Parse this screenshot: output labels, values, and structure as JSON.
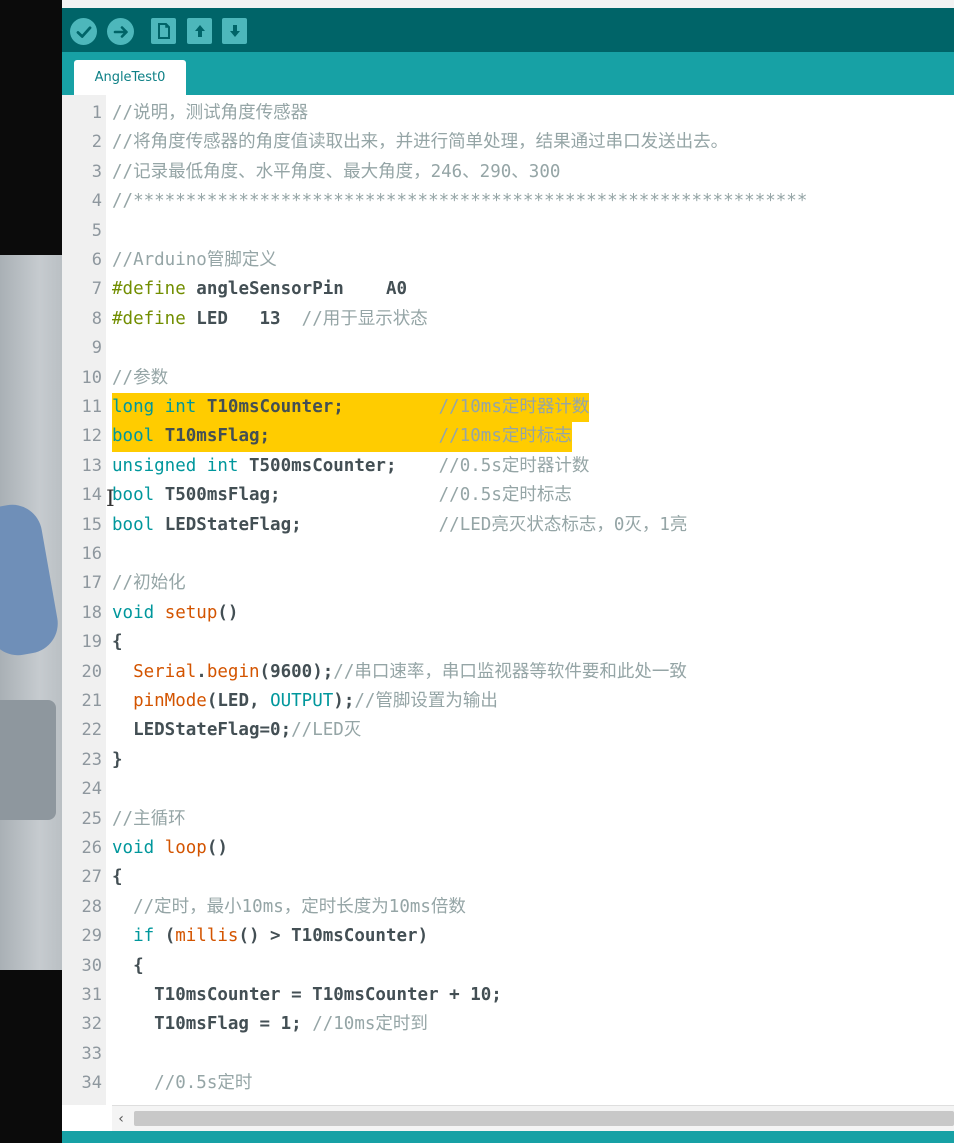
{
  "window": {
    "toolbar": {
      "icons": [
        "verify-icon",
        "upload-icon",
        "new-icon",
        "open-icon",
        "save-icon"
      ],
      "accent": "#006468",
      "button_color": "#4db7bb"
    },
    "tabs": [
      {
        "label": "AngleTest0"
      }
    ],
    "tab_color": "#17a1a5"
  },
  "editor": {
    "highlight_color": "#ffcc00",
    "lines": [
      {
        "n": "1",
        "segs": [
          {
            "t": "//说明，测试角度传感器",
            "c": "cm"
          }
        ]
      },
      {
        "n": "2",
        "segs": [
          {
            "t": "//将角度传感器的角度值读取出来，并进行简单处理，结果通过串口发送出去。",
            "c": "cm"
          }
        ]
      },
      {
        "n": "3",
        "segs": [
          {
            "t": "//记录最低角度、水平角度、最大角度，246、290、300",
            "c": "cm"
          }
        ]
      },
      {
        "n": "4",
        "segs": [
          {
            "t": "//****************************************************************",
            "c": "cm"
          }
        ]
      },
      {
        "n": "5",
        "segs": []
      },
      {
        "n": "6",
        "segs": [
          {
            "t": "//Arduino管脚定义",
            "c": "cm"
          }
        ]
      },
      {
        "n": "7",
        "segs": [
          {
            "t": "#define",
            "c": "pp"
          },
          {
            "t": " angleSensorPin    A0",
            "c": "id"
          }
        ]
      },
      {
        "n": "8",
        "segs": [
          {
            "t": "#define",
            "c": "pp"
          },
          {
            "t": " LED   13  ",
            "c": "id"
          },
          {
            "t": "//用于显示状态",
            "c": "cm"
          }
        ]
      },
      {
        "n": "9",
        "segs": []
      },
      {
        "n": "10",
        "segs": [
          {
            "t": "//参数",
            "c": "cm"
          }
        ]
      },
      {
        "n": "11",
        "hl": true,
        "segs": [
          {
            "t": "long",
            "c": "kw"
          },
          {
            "t": " ",
            "c": "id"
          },
          {
            "t": "int",
            "c": "kw"
          },
          {
            "t": " T10msCounter;         ",
            "c": "id"
          },
          {
            "t": "//10ms定时器计数",
            "c": "cm"
          }
        ]
      },
      {
        "n": "12",
        "hl": true,
        "segs": [
          {
            "t": "bool",
            "c": "kw"
          },
          {
            "t": " T10msFlag;                ",
            "c": "id"
          },
          {
            "t": "//10ms定时标志",
            "c": "cm"
          }
        ]
      },
      {
        "n": "13",
        "segs": [
          {
            "t": "unsigned",
            "c": "kw"
          },
          {
            "t": " ",
            "c": "id"
          },
          {
            "t": "int",
            "c": "kw"
          },
          {
            "t": " T500msCounter;    ",
            "c": "id"
          },
          {
            "t": "//0.5s定时器计数",
            "c": "cm"
          }
        ]
      },
      {
        "n": "14",
        "segs": [
          {
            "t": "bool",
            "c": "kw"
          },
          {
            "t": " T500msFlag;               ",
            "c": "id"
          },
          {
            "t": "//0.5s定时标志",
            "c": "cm"
          }
        ]
      },
      {
        "n": "15",
        "segs": [
          {
            "t": "bool",
            "c": "kw"
          },
          {
            "t": " LEDStateFlag;             ",
            "c": "id"
          },
          {
            "t": "//LED亮灭状态标志，0灭，1亮",
            "c": "cm"
          }
        ]
      },
      {
        "n": "16",
        "segs": []
      },
      {
        "n": "17",
        "segs": [
          {
            "t": "//初始化",
            "c": "cm"
          }
        ]
      },
      {
        "n": "18",
        "segs": [
          {
            "t": "void",
            "c": "kw"
          },
          {
            "t": " ",
            "c": "id"
          },
          {
            "t": "setup",
            "c": "fn"
          },
          {
            "t": "()",
            "c": "id"
          }
        ]
      },
      {
        "n": "19",
        "segs": [
          {
            "t": "{",
            "c": "id"
          }
        ]
      },
      {
        "n": "20",
        "segs": [
          {
            "t": "  ",
            "c": "id"
          },
          {
            "t": "Serial",
            "c": "fn"
          },
          {
            "t": ".",
            "c": "id"
          },
          {
            "t": "begin",
            "c": "fn"
          },
          {
            "t": "(9600);",
            "c": "id"
          },
          {
            "t": "//串口速率，串口监视器等软件要和此处一致",
            "c": "cm"
          }
        ]
      },
      {
        "n": "21",
        "segs": [
          {
            "t": "  ",
            "c": "id"
          },
          {
            "t": "pinMode",
            "c": "fn"
          },
          {
            "t": "(LED, ",
            "c": "id"
          },
          {
            "t": "OUTPUT",
            "c": "ct"
          },
          {
            "t": ");",
            "c": "id"
          },
          {
            "t": "//管脚设置为输出",
            "c": "cm"
          }
        ]
      },
      {
        "n": "22",
        "segs": [
          {
            "t": "  LEDStateFlag=0;",
            "c": "id"
          },
          {
            "t": "//LED灭",
            "c": "cm"
          }
        ]
      },
      {
        "n": "23",
        "segs": [
          {
            "t": "}",
            "c": "id"
          }
        ]
      },
      {
        "n": "24",
        "segs": []
      },
      {
        "n": "25",
        "segs": [
          {
            "t": "//主循环",
            "c": "cm"
          }
        ]
      },
      {
        "n": "26",
        "segs": [
          {
            "t": "void",
            "c": "kw"
          },
          {
            "t": " ",
            "c": "id"
          },
          {
            "t": "loop",
            "c": "fn"
          },
          {
            "t": "()",
            "c": "id"
          }
        ]
      },
      {
        "n": "27",
        "segs": [
          {
            "t": "{",
            "c": "id"
          }
        ]
      },
      {
        "n": "28",
        "segs": [
          {
            "t": "  ",
            "c": "id"
          },
          {
            "t": "//定时，最小10ms，定时长度为10ms倍数",
            "c": "cm"
          }
        ]
      },
      {
        "n": "29",
        "segs": [
          {
            "t": "  ",
            "c": "id"
          },
          {
            "t": "if",
            "c": "kw"
          },
          {
            "t": " (",
            "c": "id"
          },
          {
            "t": "millis",
            "c": "fn"
          },
          {
            "t": "() > T10msCounter)",
            "c": "id"
          }
        ]
      },
      {
        "n": "30",
        "segs": [
          {
            "t": "  {",
            "c": "id"
          }
        ]
      },
      {
        "n": "31",
        "segs": [
          {
            "t": "    T10msCounter = T10msCounter + 10;",
            "c": "id"
          }
        ]
      },
      {
        "n": "32",
        "segs": [
          {
            "t": "    T10msFlag = 1; ",
            "c": "id"
          },
          {
            "t": "//10ms定时到",
            "c": "cm"
          }
        ]
      },
      {
        "n": "33",
        "segs": []
      },
      {
        "n": "34",
        "segs": [
          {
            "t": "    ",
            "c": "id"
          },
          {
            "t": "//0.5s定时",
            "c": "cm"
          }
        ]
      }
    ]
  },
  "scrollbar": {
    "left_arrow": "‹"
  }
}
